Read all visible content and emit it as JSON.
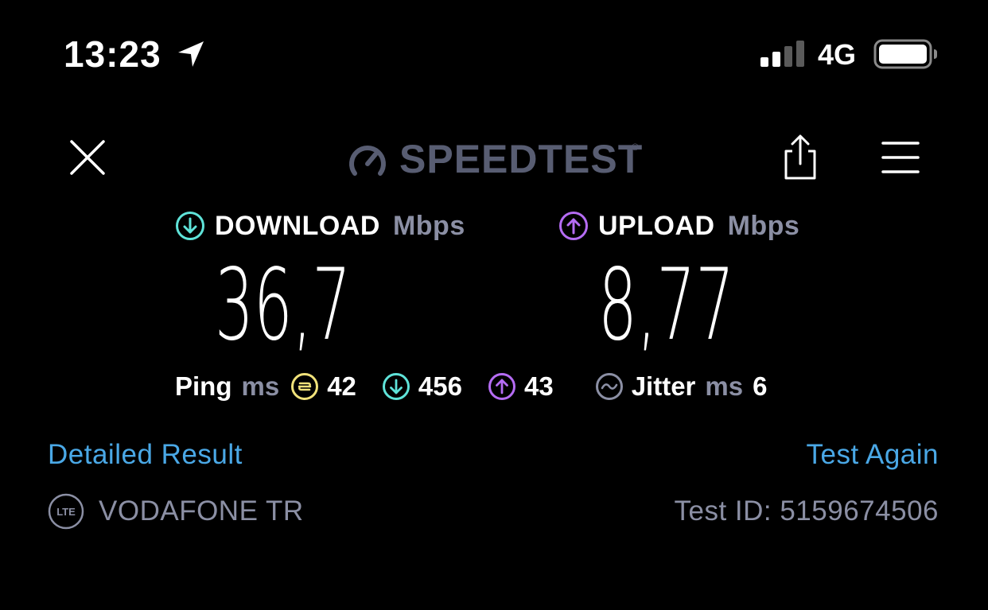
{
  "status_bar": {
    "time": "13:23",
    "network": "4G",
    "signal_bars_filled": 2,
    "signal_bars_total": 4,
    "icons": [
      "location-arrow-icon",
      "signal-icon",
      "battery-icon"
    ]
  },
  "header": {
    "logo_text": "SPEEDTEST",
    "icons": [
      "close-icon",
      "speedtest-gauge-icon",
      "share-icon",
      "menu-icon"
    ]
  },
  "download": {
    "label": "DOWNLOAD",
    "unit": "Mbps",
    "value": "36,7",
    "color": "#5fe3d9"
  },
  "upload": {
    "label": "UPLOAD",
    "unit": "Mbps",
    "value": "8,77",
    "color": "#b56cf4"
  },
  "ping": {
    "label": "Ping",
    "unit": "ms",
    "idle": "42",
    "download": "456",
    "upload": "43",
    "idle_color": "#f1e27a"
  },
  "jitter": {
    "label": "Jitter",
    "unit": "ms",
    "value": "6"
  },
  "links": {
    "detailed": "Detailed Result",
    "again": "Test Again",
    "color": "#4aa8e6"
  },
  "footer": {
    "lte_badge": "LTE",
    "carrier": "VODAFONE TR",
    "test_id": "Test ID: 5159674506"
  }
}
